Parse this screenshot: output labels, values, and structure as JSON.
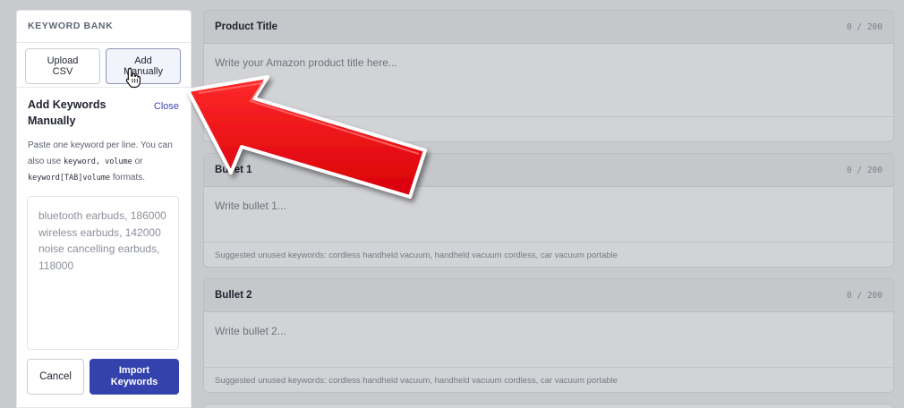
{
  "sidebar": {
    "heading": "KEYWORD BANK",
    "upload_label": "Upload\nCSV",
    "manual_label": "Add\nManually",
    "section_title": "Add Keywords Manually",
    "close_label": "Close",
    "help_prefix": "Paste one keyword per line. You can also use ",
    "help_code1": "keyword, volume",
    "help_mid": " or ",
    "help_code2": "keyword[TAB]volume",
    "help_suffix": " formats.",
    "textarea_placeholder": "bluetooth earbuds, 186000\nwireless earbuds, 142000\nnoise cancelling earbuds, 118000",
    "cancel_label": "Cancel",
    "import_label": "Import\nKeywords"
  },
  "cards": {
    "title": {
      "label": "Product Title",
      "count": "0 / 200",
      "placeholder": "Write your Amazon product title here..."
    },
    "bullet1": {
      "label": "Bullet 1",
      "count": "0 / 200",
      "placeholder": "Write bullet 1...",
      "suggestions": "Suggested unused keywords: cordless handheld vacuum, handheld vacuum cordless, car vacuum portable"
    },
    "bullet2": {
      "label": "Bullet 2",
      "count": "0 / 200",
      "placeholder": "Write bullet 2...",
      "suggestions": "Suggested unused keywords: cordless handheld vacuum, handheld vacuum cordless, car vacuum portable"
    }
  },
  "overlay": {
    "arrow_color": "#e8000b",
    "cursor_icon": "hand-pointer-icon"
  },
  "colors": {
    "accent": "#3442ad",
    "link": "#3d46b0"
  }
}
